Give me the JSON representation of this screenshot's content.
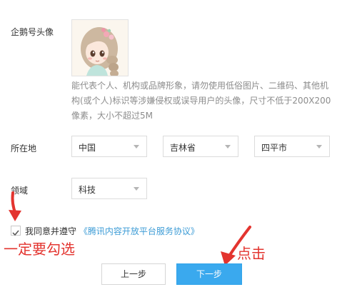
{
  "form": {
    "avatar_label": "企鹅号头像",
    "avatar_hint": "能代表个人、机构或品牌形象，请勿使用低俗图片、二维码、其他机构(或个人)标识等涉嫌侵权或误导用户的头像，尺寸不低于200X200像素，大小不超过5M",
    "location_label": "所在地",
    "location": {
      "country": "中国",
      "province": "吉林省",
      "city": "四平市"
    },
    "domain_label": "领域",
    "domain_value": "科技",
    "agree_text": "我同意并遵守",
    "agree_link": "《腾讯内容开放平台服务协议》",
    "agree_checked": true
  },
  "buttons": {
    "prev": "上一步",
    "next": "下一步"
  },
  "annotations": {
    "must_check": "一定要勾选",
    "click": "点击",
    "color": "#e3342f"
  },
  "colors": {
    "primary": "#3aa9ee",
    "link": "#3d9cd6"
  }
}
